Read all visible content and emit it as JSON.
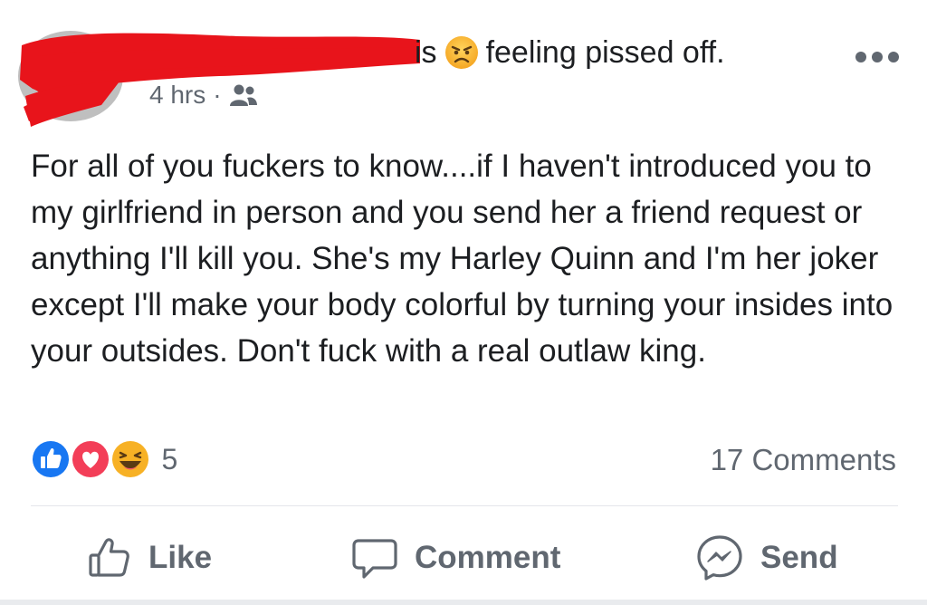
{
  "post": {
    "author_connector": "is",
    "feeling_emoji": "angry-face-icon",
    "feeling_text": "feeling pissed off.",
    "timestamp": "4 hrs",
    "separator": "·",
    "audience_icon": "friends-icon",
    "body": "For all of you fuckers to know....if I haven't introduced you to my girlfriend in person and you send her a friend request or anything I'll kill you. She's my Harley Quinn and I'm her joker except I'll make your body colorful by turning your insides into your outsides. Don't fuck with a real outlaw king."
  },
  "reactions": {
    "icons": [
      "like-reaction-icon",
      "love-reaction-icon",
      "haha-reaction-icon"
    ],
    "count": "5",
    "comments": "17 Comments"
  },
  "actions": {
    "like": "Like",
    "comment": "Comment",
    "send": "Send"
  },
  "colors": {
    "text": "#1c1e21",
    "muted": "#606770",
    "like_blue": "#1877f2",
    "love_red": "#f33e58",
    "haha_yellow": "#f7b125",
    "redaction": "#e8141b"
  }
}
